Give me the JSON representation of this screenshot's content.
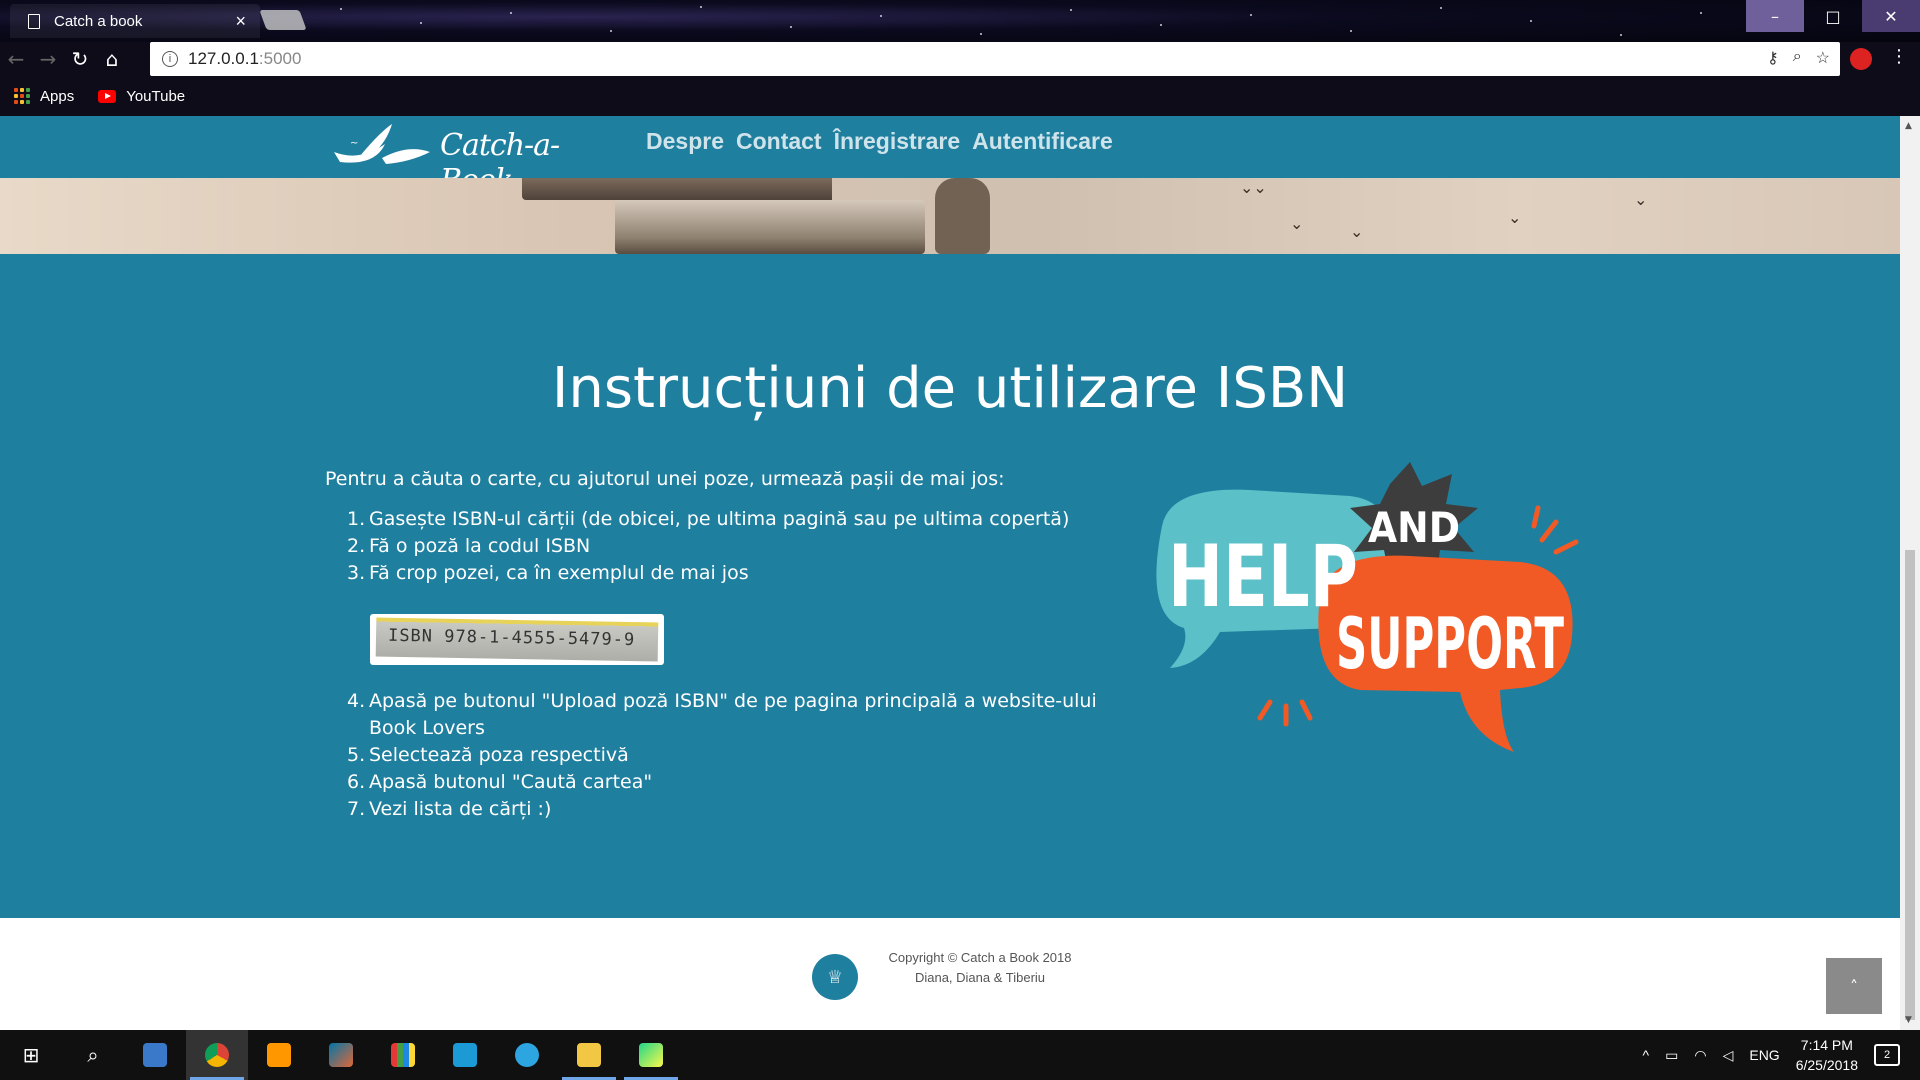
{
  "browser": {
    "tab_title": "Catch a book",
    "tab_close": "×",
    "url_host": "127.0.0.1",
    "url_port": ":5000",
    "bookmarks": [
      {
        "label": "Apps",
        "icon": "apps-grid-icon"
      },
      {
        "label": "YouTube",
        "icon": "youtube-icon"
      }
    ]
  },
  "site": {
    "logo_text": "Catch-a- Book",
    "nav": [
      "Despre",
      "Contact",
      "Înregistrare",
      "Autentificare"
    ]
  },
  "content": {
    "title": "Instrucțiuni de utilizare ISBN",
    "intro": "Pentru a căuta o carte, cu ajutorul unei poze, urmează pașii de mai jos:",
    "steps_a": [
      {
        "num": "1.",
        "text": "Gasește ISBN-ul cărții (de obicei, pe ultima pagină sau pe ultima copertă)"
      },
      {
        "num": "2.",
        "text": "Fă o poză la codul ISBN"
      },
      {
        "num": "3.",
        "text": "Fă crop pozei, ca în exemplul de mai jos"
      }
    ],
    "isbn_example": "ISBN 978-1-4555-5479-9",
    "steps_b": [
      {
        "num": "4.",
        "text": "Apasă pe butonul \"Upload poză ISBN\" de pe pagina principală a website-ului Book Lovers"
      },
      {
        "num": "5.",
        "text": "Selectează poza respectivă"
      },
      {
        "num": "6.",
        "text": "Apasă butonul \"Caută cartea\""
      },
      {
        "num": "7.",
        "text": "Vezi lista de cărți :)"
      }
    ],
    "art_help": "HELP",
    "art_and": "AND",
    "art_support": "SUPPORT"
  },
  "footer": {
    "copyright_line1": "Copyright © Catch a Book 2018",
    "copyright_line2": "Diana, Diana & Tiberiu"
  },
  "taskbar": {
    "apps": [
      "windows-start-icon",
      "search-icon",
      "desktop-app-icon",
      "chrome-icon",
      "sublime-icon",
      "matlab-icon",
      "chart-app-icon",
      "instagram-icon",
      "telegram-icon",
      "file-explorer-icon",
      "pycharm-icon"
    ],
    "language": "ENG",
    "time": "7:14 PM",
    "date": "6/25/2018",
    "notifications": "2"
  },
  "colors": {
    "page_bg": "#1f7f9f",
    "help_blue": "#5bc0c8",
    "support_orange": "#f15a24",
    "and_dark": "#3d3d3d"
  }
}
